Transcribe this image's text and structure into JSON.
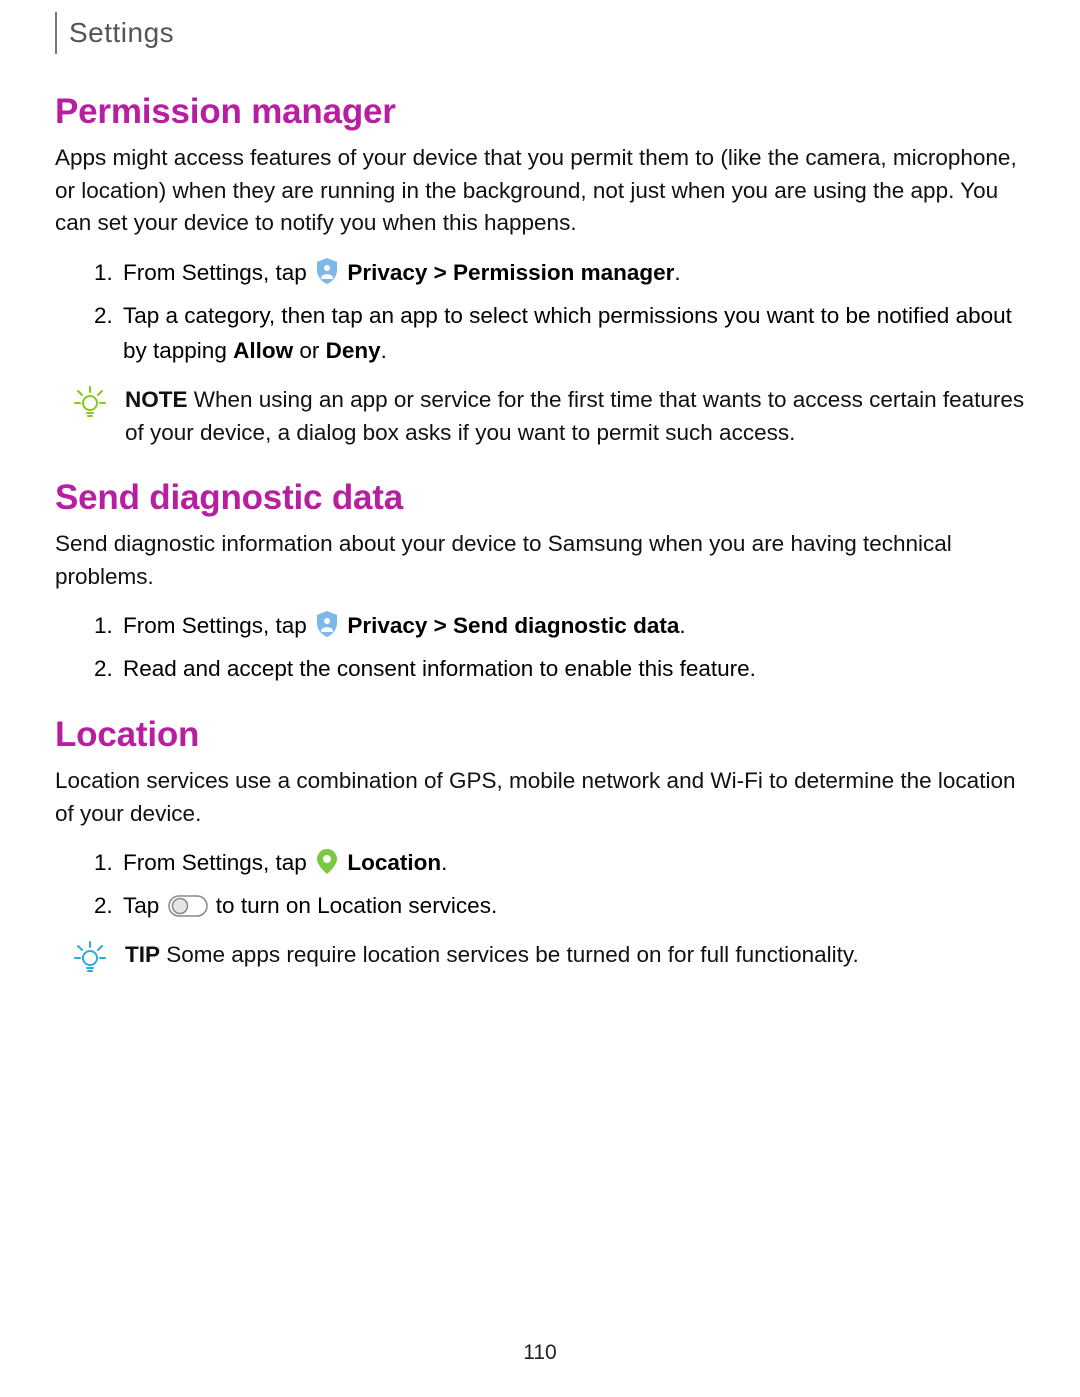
{
  "header": {
    "breadcrumb": "Settings"
  },
  "sections": {
    "permission": {
      "heading": "Permission manager",
      "intro": "Apps might access features of your device that you permit them to (like the camera, microphone, or location) when they are running in the background, not just when you are using the app. You can set your device to notify you when this happens.",
      "step1_prefix": "From Settings, tap ",
      "step1_bold": "Privacy > Permission manager",
      "step1_suffix": ".",
      "step2_a": "Tap a category, then tap an app to select which permissions you want to be notified about by tapping ",
      "step2_allow": "Allow",
      "step2_or": " or ",
      "step2_deny": "Deny",
      "step2_end": ".",
      "note_label": "NOTE",
      "note_text": "  When using an app or service for the first time that wants to access certain features of your device, a dialog box asks if you want to permit such access."
    },
    "diagnostic": {
      "heading": "Send diagnostic data",
      "intro": "Send diagnostic information about your device to Samsung when you are having technical problems.",
      "step1_prefix": "From Settings, tap ",
      "step1_bold": "Privacy > Send diagnostic data",
      "step1_suffix": ".",
      "step2": "Read and accept the consent information to enable this feature."
    },
    "location": {
      "heading": "Location",
      "intro": "Location services use a combination of GPS, mobile network and Wi-Fi to determine the location of your device.",
      "step1_prefix": "From Settings, tap ",
      "step1_bold": "Location",
      "step1_suffix": ".",
      "step2_prefix": "Tap ",
      "step2_suffix": " to turn on Location services.",
      "tip_label": "TIP",
      "tip_text": "  Some apps require location services be turned on for full functionality."
    }
  },
  "page_number": "110"
}
